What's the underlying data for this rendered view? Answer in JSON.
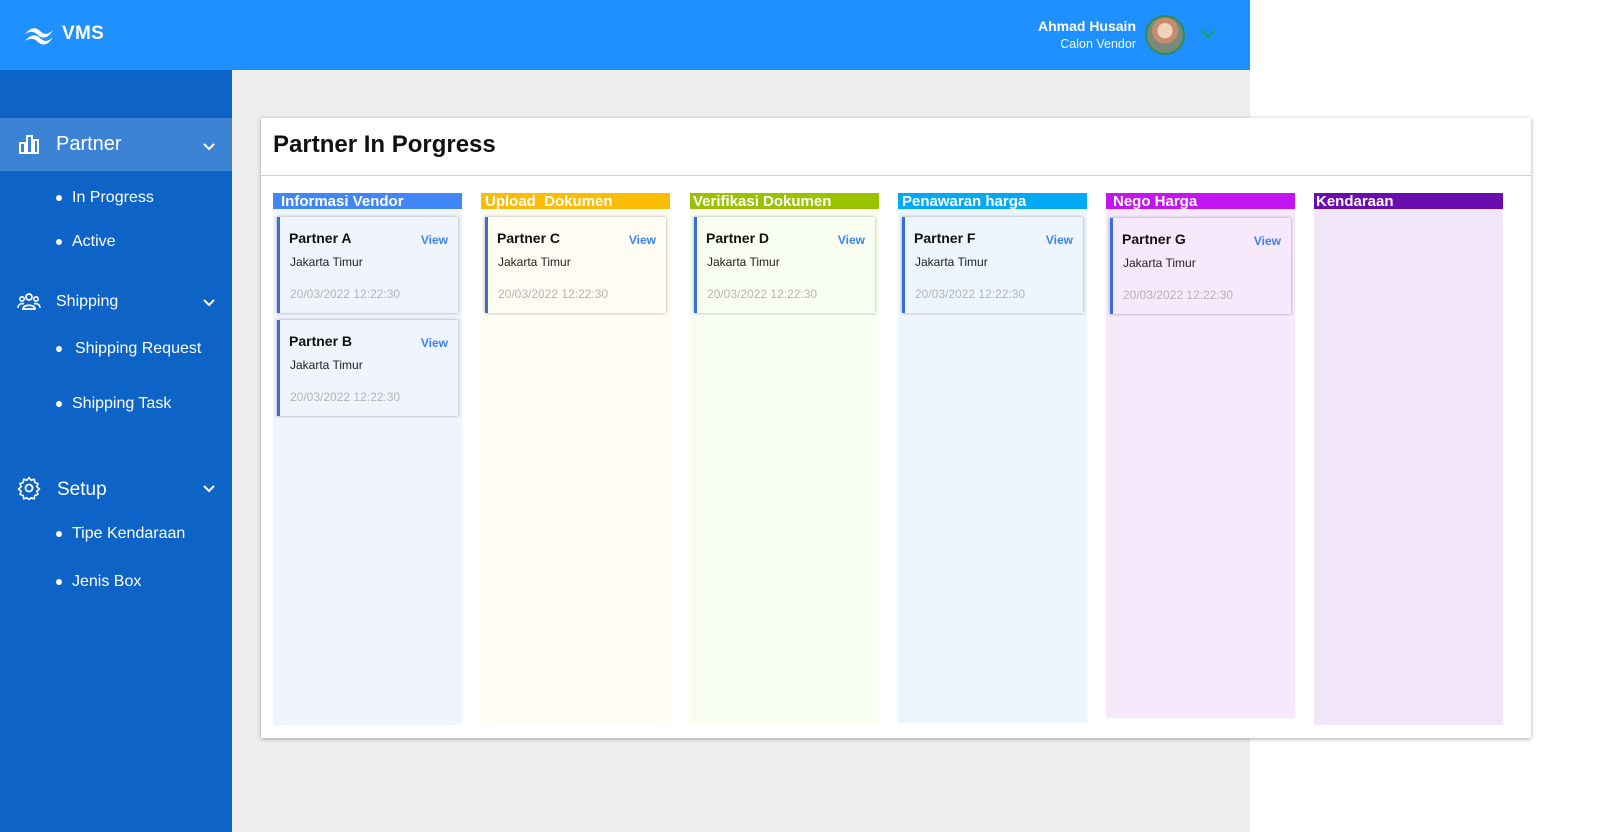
{
  "app": {
    "brand": "VMS"
  },
  "user": {
    "name": "Ahmad Husain",
    "role": "Calon Vendor"
  },
  "sidebar": {
    "groups": [
      {
        "label": "Partner",
        "icon": "bar-chart-icon",
        "items": [
          "In Progress",
          "Active"
        ]
      },
      {
        "label": "Shipping",
        "icon": "users-icon",
        "items": [
          "Shipping Request",
          "Shipping Task"
        ]
      },
      {
        "label": "Setup",
        "icon": "gear-icon",
        "items": [
          "Tipe Kendaraan",
          "Jenis Box"
        ]
      }
    ]
  },
  "page": {
    "title": "Partner In Porgress"
  },
  "columns": [
    {
      "title": "Informasi Vendor",
      "color": "#4285f4",
      "bg": "#f0f4fd",
      "cards": [
        {
          "name": "Partner A",
          "view": "View",
          "city": "Jakarta Timur",
          "date": "20/03/2022 12:22:30"
        },
        {
          "name": "Partner B",
          "view": "View",
          "city": "Jakarta Timur",
          "date": "20/03/2022 12:22:30"
        }
      ]
    },
    {
      "title": "Upload  Dokumen",
      "color": "#fbbc04",
      "bg": "#fffcf3",
      "cards": [
        {
          "name": "Partner C",
          "view": "View",
          "city": "Jakarta Timur",
          "date": "20/03/2022 12:22:30"
        }
      ]
    },
    {
      "title": "Verifikasi Dokumen",
      "color": "#9ac200",
      "bg": "#f9fff0",
      "cards": [
        {
          "name": "Partner D",
          "view": "View",
          "city": "Jakarta Timur",
          "date": "20/03/2022 12:22:30"
        }
      ]
    },
    {
      "title": "Penawaran harga",
      "color": "#03a9f4",
      "bg": "#eef6fd",
      "cards": [
        {
          "name": "Partner F",
          "view": "View",
          "city": "Jakarta Timur",
          "date": "20/03/2022 12:22:30"
        }
      ]
    },
    {
      "title": "Nego Harga",
      "color": "#c215f0",
      "bg": "#f7e8fc",
      "cards": [
        {
          "name": "Partner G",
          "view": "View",
          "city": "Jakarta Timur",
          "date": "20/03/2022 12:22:30"
        }
      ]
    },
    {
      "title": "Kendaraan",
      "color": "#6a0dad",
      "bg": "#f0e6f7",
      "cards": []
    }
  ]
}
